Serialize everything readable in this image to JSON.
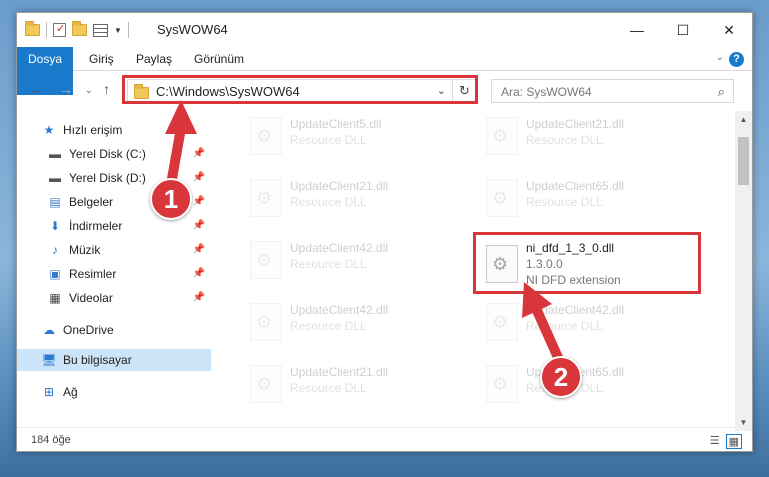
{
  "window": {
    "title": "SysWOW64"
  },
  "ribbon": {
    "tabs": [
      "Dosya",
      "Giriş",
      "Paylaş",
      "Görünüm"
    ]
  },
  "address": {
    "path": "C:\\Windows\\SysWOW64"
  },
  "search": {
    "placeholder": "Ara: SysWOW64"
  },
  "navpane": {
    "items": [
      {
        "label": "Hızlı erişim",
        "icon": "star-icon"
      },
      {
        "label": "Yerel Disk (C:)",
        "icon": "drive-icon"
      },
      {
        "label": "Yerel Disk (D:)",
        "icon": "drive-icon"
      },
      {
        "label": "Belgeler",
        "icon": "documents-icon"
      },
      {
        "label": "İndirmeler",
        "icon": "download-icon"
      },
      {
        "label": "Müzik",
        "icon": "music-icon"
      },
      {
        "label": "Resimler",
        "icon": "pictures-icon"
      },
      {
        "label": "Videolar",
        "icon": "video-icon"
      },
      {
        "label": "OneDrive",
        "icon": "cloud-icon"
      },
      {
        "label": "Bu bilgisayar",
        "icon": "computer-icon"
      },
      {
        "label": "Ağ",
        "icon": "network-icon"
      }
    ]
  },
  "files": [
    {
      "name": "UpdateClient5.dll",
      "type": "Resource DLL"
    },
    {
      "name": "UpdateClient21.dll",
      "type": "Resource DLL"
    },
    {
      "name": "UpdateClient21.dll",
      "type": "Resource DLL"
    },
    {
      "name": "UpdateClient65.dll",
      "type": "Resource DLL"
    },
    {
      "name": "UpdateClient42.dll",
      "type": "Resource DLL"
    },
    {
      "name": "UpdateClient42.dll",
      "type": "Resource DLL"
    },
    {
      "name": "UpdateClient42.dll",
      "type": "Resource DLL"
    },
    {
      "name": "UpdateClient21.dll",
      "type": "Resource DLL"
    },
    {
      "name": "UpdateClient65.dll",
      "type": "Resource DLL"
    }
  ],
  "highlighted_file": {
    "name": "ni_dfd_1_3_0.dll",
    "version": "1.3.0.0",
    "description": "NI DFD extension"
  },
  "status": {
    "count": "184 öğe"
  },
  "callouts": [
    "1",
    "2"
  ],
  "colors": {
    "accent": "#1979ca",
    "highlight": "#d8363a"
  }
}
